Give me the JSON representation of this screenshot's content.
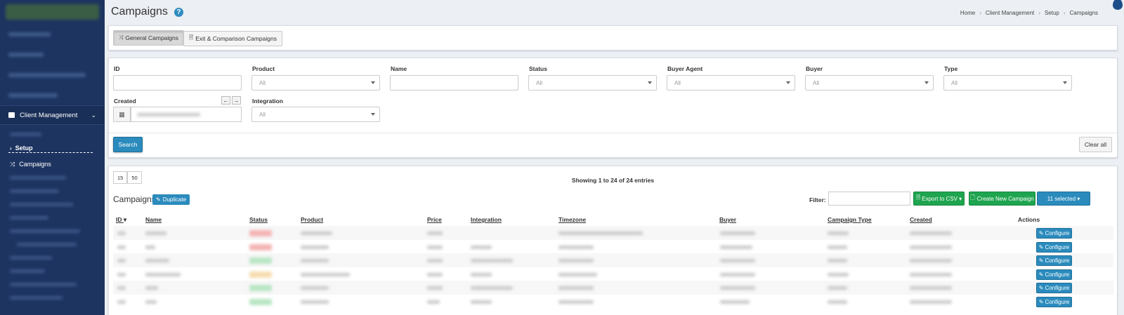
{
  "sidebar": {
    "section": "Client Management",
    "setup_label": "Setup",
    "campaigns_label": "Campaigns"
  },
  "header": {
    "title": "Campaigns",
    "help": "?",
    "breadcrumb": [
      "Home",
      "Client Management",
      "Setup",
      "Campaigns"
    ]
  },
  "tabs": {
    "general": "General Campaigns",
    "exit": "Exit & Comparison Campaigns"
  },
  "filters": {
    "id_label": "ID",
    "product_label": "Product",
    "product_value": "All",
    "name_label": "Name",
    "status_label": "Status",
    "status_value": "All",
    "buyer_agent_label": "Buyer Agent",
    "buyer_agent_value": "All",
    "buyer_label": "Buyer",
    "buyer_value": "All",
    "type_label": "Type",
    "type_value": "All",
    "created_label": "Created",
    "integration_label": "Integration",
    "integration_value": "All",
    "search_button": "Search",
    "clear_button": "Clear all"
  },
  "table": {
    "page_sizes": [
      "15",
      "50"
    ],
    "showing": "Showing 1 to 24 of 24 entries",
    "title": "Campaigns",
    "duplicate_button": "Duplicate",
    "filter_label": "Filter:",
    "export_button": "Export to CSV ▾",
    "create_button": "Create New Campaign",
    "selected_button": "11 selected ▾",
    "columns": [
      "ID",
      "Name",
      "Status",
      "Product",
      "Price",
      "Integration",
      "Timezone",
      "Buyer",
      "Campaign Type",
      "Created",
      "Actions"
    ],
    "id_sort_indicator": "▾",
    "configure_label": "Configure",
    "status_colors": [
      "#f4b4b4",
      "#f4b4b4",
      "#b9e6c4",
      "#f6ddb0",
      "#b9e6c4",
      "#b9e6c4"
    ]
  }
}
